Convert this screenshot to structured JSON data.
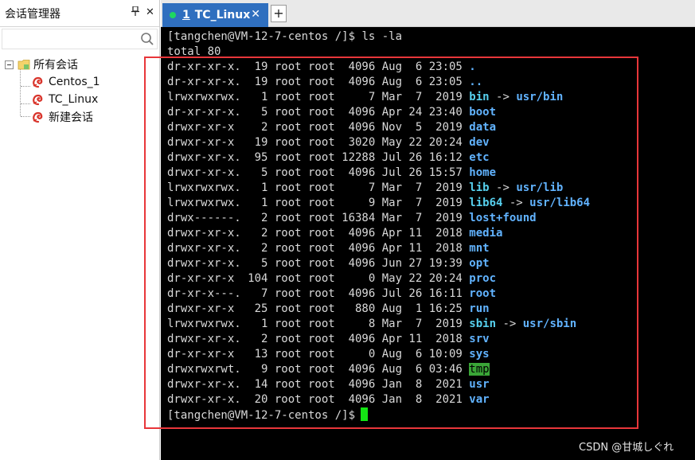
{
  "session_panel": {
    "title": "会话管理器",
    "pin_icon": "pin-icon",
    "pin_glyph": "ᵖ",
    "close_glyph": "✕",
    "search": {
      "value": "",
      "placeholder": ""
    },
    "tree": {
      "root": {
        "label": "所有会话",
        "expanded": true
      },
      "sessions": [
        {
          "label": "Centos_1"
        },
        {
          "label": "TC_Linux"
        },
        {
          "label": "新建会话"
        }
      ]
    }
  },
  "tabs": [
    {
      "number": "1",
      "label": "TC_Linux",
      "active": true,
      "status_color": "#1ed760",
      "close_glyph": "✕"
    }
  ],
  "add_tab_glyph": "+",
  "terminal": {
    "prompt": "[tangchen@VM-12-7-centos /]$",
    "command": " ls -la",
    "total": "total 80",
    "entries": [
      {
        "perm": "dr-xr-xr-x.",
        "links": "19",
        "owner": "root",
        "group": "root",
        "size": "4096",
        "month": "Aug",
        "day": "6",
        "time": "23:05",
        "name": ".",
        "type": "dir"
      },
      {
        "perm": "dr-xr-xr-x.",
        "links": "19",
        "owner": "root",
        "group": "root",
        "size": "4096",
        "month": "Aug",
        "day": "6",
        "time": "23:05",
        "name": "..",
        "type": "dir"
      },
      {
        "perm": "lrwxrwxrwx.",
        "links": "1",
        "owner": "root",
        "group": "root",
        "size": "7",
        "month": "Mar",
        "day": "7",
        "time": "2019",
        "name": "bin",
        "type": "link",
        "target": "usr/bin"
      },
      {
        "perm": "dr-xr-xr-x.",
        "links": "5",
        "owner": "root",
        "group": "root",
        "size": "4096",
        "month": "Apr",
        "day": "24",
        "time": "23:40",
        "name": "boot",
        "type": "dir"
      },
      {
        "perm": "drwxr-xr-x",
        "links": "2",
        "owner": "root",
        "group": "root",
        "size": "4096",
        "month": "Nov",
        "day": "5",
        "time": "2019",
        "name": "data",
        "type": "dir"
      },
      {
        "perm": "drwxr-xr-x",
        "links": "19",
        "owner": "root",
        "group": "root",
        "size": "3020",
        "month": "May",
        "day": "22",
        "time": "20:24",
        "name": "dev",
        "type": "dir"
      },
      {
        "perm": "drwxr-xr-x.",
        "links": "95",
        "owner": "root",
        "group": "root",
        "size": "12288",
        "month": "Jul",
        "day": "26",
        "time": "16:12",
        "name": "etc",
        "type": "dir"
      },
      {
        "perm": "drwxr-xr-x.",
        "links": "5",
        "owner": "root",
        "group": "root",
        "size": "4096",
        "month": "Jul",
        "day": "26",
        "time": "15:57",
        "name": "home",
        "type": "dir"
      },
      {
        "perm": "lrwxrwxrwx.",
        "links": "1",
        "owner": "root",
        "group": "root",
        "size": "7",
        "month": "Mar",
        "day": "7",
        "time": "2019",
        "name": "lib",
        "type": "link",
        "target": "usr/lib"
      },
      {
        "perm": "lrwxrwxrwx.",
        "links": "1",
        "owner": "root",
        "group": "root",
        "size": "9",
        "month": "Mar",
        "day": "7",
        "time": "2019",
        "name": "lib64",
        "type": "link",
        "target": "usr/lib64"
      },
      {
        "perm": "drwx------.",
        "links": "2",
        "owner": "root",
        "group": "root",
        "size": "16384",
        "month": "Mar",
        "day": "7",
        "time": "2019",
        "name": "lost+found",
        "type": "dir"
      },
      {
        "perm": "drwxr-xr-x.",
        "links": "2",
        "owner": "root",
        "group": "root",
        "size": "4096",
        "month": "Apr",
        "day": "11",
        "time": "2018",
        "name": "media",
        "type": "dir"
      },
      {
        "perm": "drwxr-xr-x.",
        "links": "2",
        "owner": "root",
        "group": "root",
        "size": "4096",
        "month": "Apr",
        "day": "11",
        "time": "2018",
        "name": "mnt",
        "type": "dir"
      },
      {
        "perm": "drwxr-xr-x.",
        "links": "5",
        "owner": "root",
        "group": "root",
        "size": "4096",
        "month": "Jun",
        "day": "27",
        "time": "19:39",
        "name": "opt",
        "type": "dir"
      },
      {
        "perm": "dr-xr-xr-x",
        "links": "104",
        "owner": "root",
        "group": "root",
        "size": "0",
        "month": "May",
        "day": "22",
        "time": "20:24",
        "name": "proc",
        "type": "dir"
      },
      {
        "perm": "dr-xr-x---.",
        "links": "7",
        "owner": "root",
        "group": "root",
        "size": "4096",
        "month": "Jul",
        "day": "26",
        "time": "16:11",
        "name": "root",
        "type": "dir"
      },
      {
        "perm": "drwxr-xr-x",
        "links": "25",
        "owner": "root",
        "group": "root",
        "size": "880",
        "month": "Aug",
        "day": "1",
        "time": "16:25",
        "name": "run",
        "type": "dir"
      },
      {
        "perm": "lrwxrwxrwx.",
        "links": "1",
        "owner": "root",
        "group": "root",
        "size": "8",
        "month": "Mar",
        "day": "7",
        "time": "2019",
        "name": "sbin",
        "type": "link",
        "target": "usr/sbin"
      },
      {
        "perm": "drwxr-xr-x.",
        "links": "2",
        "owner": "root",
        "group": "root",
        "size": "4096",
        "month": "Apr",
        "day": "11",
        "time": "2018",
        "name": "srv",
        "type": "dir"
      },
      {
        "perm": "dr-xr-xr-x",
        "links": "13",
        "owner": "root",
        "group": "root",
        "size": "0",
        "month": "Aug",
        "day": "6",
        "time": "10:09",
        "name": "sys",
        "type": "dir"
      },
      {
        "perm": "drwxrwxrwt.",
        "links": "9",
        "owner": "root",
        "group": "root",
        "size": "4096",
        "month": "Aug",
        "day": "6",
        "time": "03:46",
        "name": "tmp",
        "type": "sticky"
      },
      {
        "perm": "drwxr-xr-x.",
        "links": "14",
        "owner": "root",
        "group": "root",
        "size": "4096",
        "month": "Jan",
        "day": "8",
        "time": "2021",
        "name": "usr",
        "type": "dir"
      },
      {
        "perm": "drwxr-xr-x.",
        "links": "20",
        "owner": "root",
        "group": "root",
        "size": "4096",
        "month": "Jan",
        "day": "8",
        "time": "2021",
        "name": "var",
        "type": "dir"
      }
    ],
    "link_arrow": "->",
    "final_prompt": "[tangchen@VM-12-7-centos /]$",
    "colors": {
      "background": "#000000",
      "text": "#d9d9d9",
      "directory": "#61b3ff",
      "link_target": "#56d0ee",
      "sticky_bg": "#3aa637",
      "cursor": "#14e614"
    }
  },
  "annotation_color": "#e8363a",
  "watermark": "CSDN @甘城しぐれ"
}
